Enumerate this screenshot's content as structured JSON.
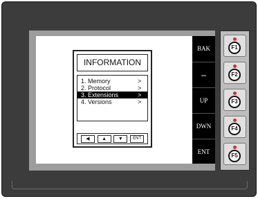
{
  "screen": {
    "title": "INFORMATION",
    "menu": [
      {
        "label": "1. Memory",
        "arrow": ">"
      },
      {
        "label": "2. Protocol",
        "arrow": ">"
      },
      {
        "label": "3. Extensions",
        "arrow": ">",
        "selected": true
      },
      {
        "label": "4. Versions",
        "arrow": ">"
      }
    ],
    "nav_buttons": [
      {
        "name": "left",
        "label": "◀"
      },
      {
        "name": "up",
        "label": "▲"
      },
      {
        "name": "down",
        "label": "▼"
      },
      {
        "name": "enter",
        "label": "ENT"
      }
    ]
  },
  "softkeys": [
    "BAK",
    "–",
    "UP",
    "DWN",
    "ENT"
  ],
  "function_keys": [
    "F1",
    "F2",
    "F3",
    "F4",
    "F5"
  ],
  "colors": {
    "device_body": "#3c3c3c",
    "bezel": "#9c9c9c",
    "softkey_bar": "#000000",
    "led": "#d0302a",
    "selected_row": "#000000"
  },
  "icons": {
    "nav": [
      "left-arrow-icon",
      "up-arrow-icon",
      "down-arrow-icon"
    ],
    "function_key_led": "red-led-icon"
  }
}
